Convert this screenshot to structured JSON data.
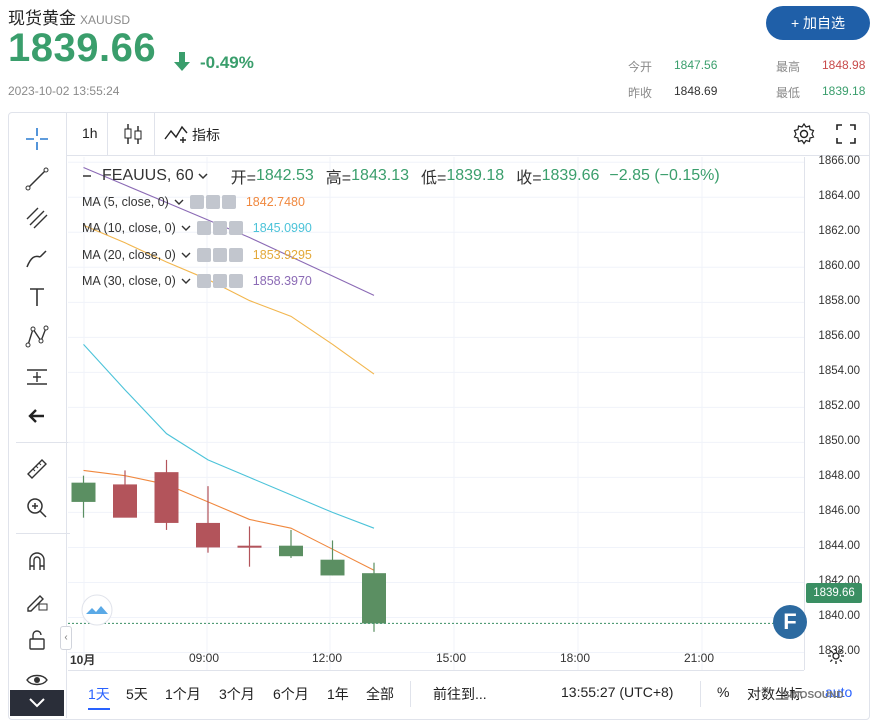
{
  "header": {
    "name": "现货黄金",
    "code": "XAUUSD",
    "price": "1839.66",
    "change_pct": "-0.49%",
    "datetime": "2023-10-02 13:55:24",
    "add_button": "+ 加自选"
  },
  "stats": {
    "open_label": "今开",
    "open_value": "1847.56",
    "high_label": "最高",
    "high_value": "1848.98",
    "prev_close_label": "昨收",
    "prev_close_value": "1848.69",
    "low_label": "最低",
    "low_value": "1839.18"
  },
  "toolbar": {
    "interval": "1h",
    "indicators_label": "指标"
  },
  "legend": {
    "symbol": "FEAUUS, 60",
    "open_label": "开=",
    "open": "1842.53",
    "high_label": "高=",
    "high": "1843.13",
    "low_label": "低=",
    "low": "1839.18",
    "close_label": "收=",
    "close": "1839.66",
    "change": "−2.85 (−0.15%)",
    "ma": [
      {
        "label": "MA (5, close, 0)",
        "value": "1842.7480",
        "color": "#f0883e"
      },
      {
        "label": "MA (10, close, 0)",
        "value": "1845.0990",
        "color": "#4cc3d9"
      },
      {
        "label": "MA (20, close, 0)",
        "value": "1853.9295",
        "color": "#f2b64e"
      },
      {
        "label": "MA (30, close, 0)",
        "value": "1858.3970",
        "color": "#8b6ab5"
      }
    ]
  },
  "price_tag": "1839.66",
  "logo_letter": "F",
  "bottom": {
    "ranges": [
      "1天",
      "5天",
      "1个月",
      "3个月",
      "6个月",
      "1年",
      "全部"
    ],
    "goto": "前往到...",
    "clock": "13:55:27 (UTC+8)",
    "percent": "%",
    "log": "对数坐标",
    "auto": "auto"
  },
  "watermark": "SINOSOUND",
  "chart_data": {
    "type": "candlestick",
    "y_ticks": [
      "1866.00",
      "1864.00",
      "1862.00",
      "1860.00",
      "1858.00",
      "1856.00",
      "1854.00",
      "1852.00",
      "1850.00",
      "1848.00",
      "1846.00",
      "1844.00",
      "1842.00",
      "1840.00",
      "1838.00"
    ],
    "x_ticks": [
      "10月",
      "09:00",
      "12:00",
      "15:00",
      "18:00",
      "21:00"
    ],
    "ylim": [
      1837.0,
      1866.3
    ],
    "candles": [
      {
        "time": "06:00",
        "open": 1846.6,
        "high": 1848.1,
        "low": 1845.7,
        "close": 1847.7
      },
      {
        "time": "07:00",
        "open": 1847.6,
        "high": 1848.4,
        "low": 1846.0,
        "close": 1845.7
      },
      {
        "time": "08:00",
        "open": 1848.3,
        "high": 1849.0,
        "low": 1845.0,
        "close": 1845.4
      },
      {
        "time": "09:00",
        "open": 1845.4,
        "high": 1847.5,
        "low": 1843.7,
        "close": 1844.0
      },
      {
        "time": "10:00",
        "open": 1844.1,
        "high": 1845.2,
        "low": 1842.9,
        "close": 1844.0
      },
      {
        "time": "11:00",
        "open": 1843.5,
        "high": 1845.0,
        "low": 1843.4,
        "close": 1844.1
      },
      {
        "time": "12:00",
        "open": 1842.4,
        "high": 1844.4,
        "low": 1842.4,
        "close": 1843.3
      },
      {
        "time": "13:00",
        "open": 1839.66,
        "high": 1843.13,
        "low": 1839.18,
        "close": 1842.53
      }
    ],
    "candle_colors": {
      "up": "#5b8f62",
      "down": "#b3545b"
    },
    "ma_series": [
      {
        "name": "MA (5, close, 0)",
        "color": "#f0883e",
        "values": [
          1848.4,
          1848.1,
          1847.6,
          1846.6,
          1845.6,
          1845.1,
          1843.9,
          1842.7
        ]
      },
      {
        "name": "MA (10, close, 0)",
        "color": "#4cc3d9",
        "values": [
          1855.6,
          1853.0,
          1850.5,
          1849.0,
          1848.0,
          1847.0,
          1846.0,
          1845.1
        ]
      },
      {
        "name": "MA (20, close, 0)",
        "color": "#f2b64e",
        "values": [
          1862.4,
          1861.4,
          1860.3,
          1859.3,
          1858.1,
          1857.2,
          1855.6,
          1853.9
        ]
      },
      {
        "name": "MA (30, close, 0)",
        "color": "#8b6ab5",
        "values": [
          1865.7,
          1864.7,
          1863.7,
          1862.7,
          1861.7,
          1860.6,
          1859.5,
          1858.4
        ]
      }
    ],
    "last_price_line": 1839.66
  }
}
